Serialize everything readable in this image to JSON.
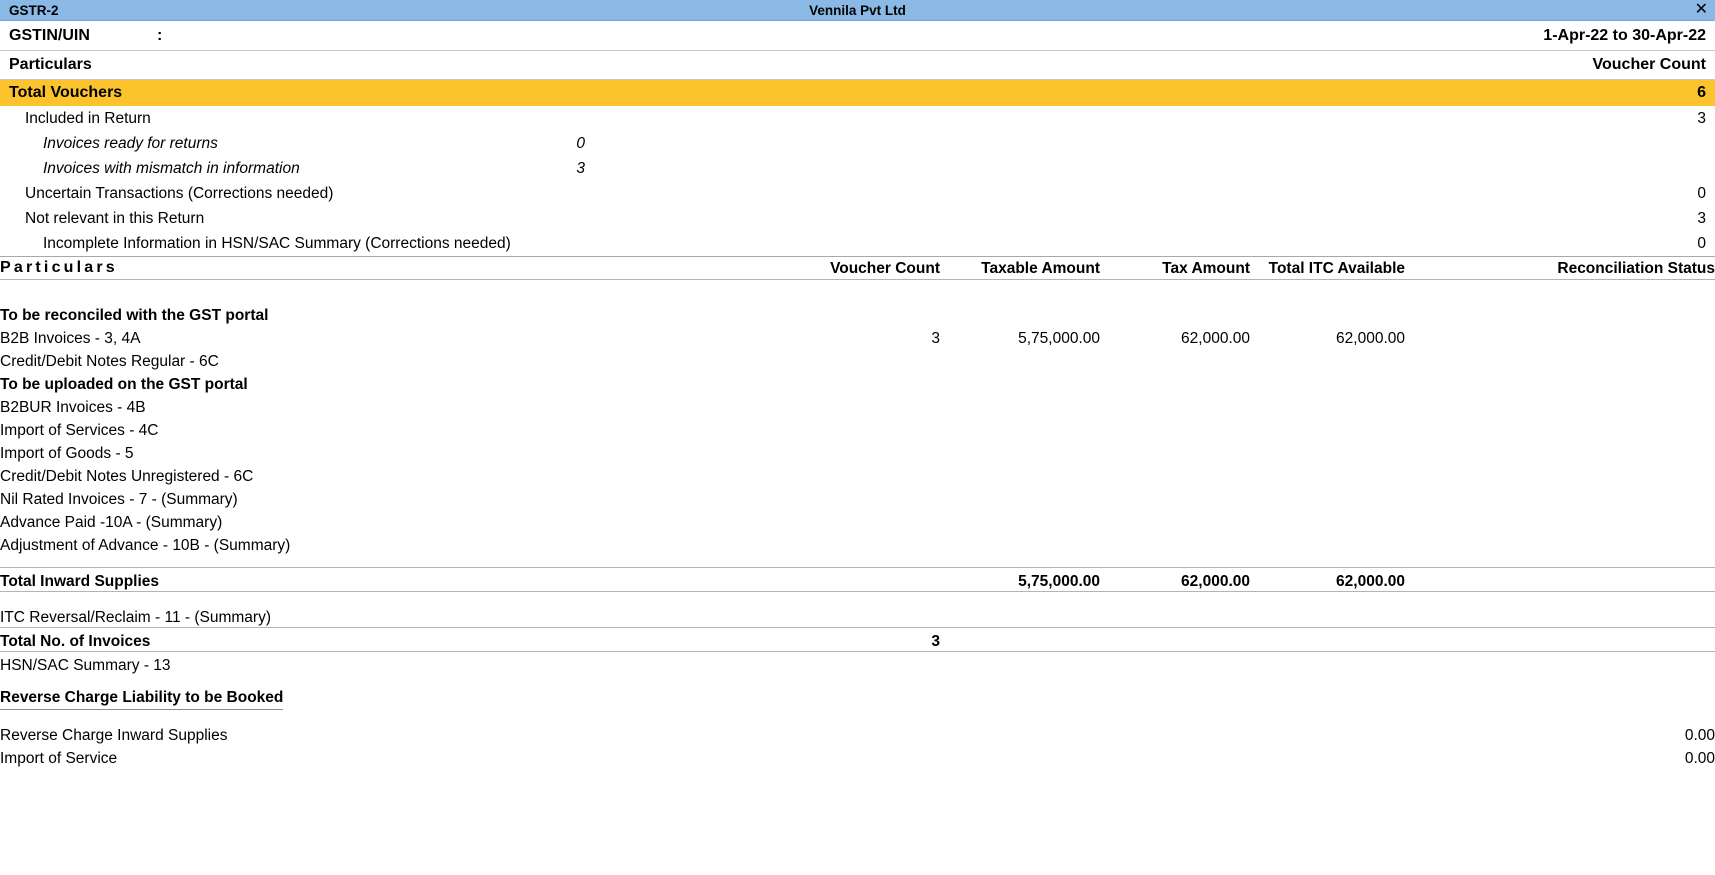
{
  "titlebar": {
    "app_name": "GSTR-2",
    "company": "Vennila Pvt Ltd",
    "close_label": "✕"
  },
  "header": {
    "gstin_label": "GSTIN/UIN",
    "colon": ":",
    "gstin_value": "",
    "period": "1-Apr-22 to 30-Apr-22",
    "particulars_label": "Particulars",
    "voucher_count_label": "Voucher Count"
  },
  "summary": {
    "total_vouchers": {
      "label": "Total Vouchers",
      "count": "6"
    },
    "rows": [
      {
        "label": "Included in Return",
        "indent": 1,
        "italic": false,
        "mid": "",
        "value": "3"
      },
      {
        "label": "Invoices ready for returns",
        "indent": 2,
        "italic": true,
        "mid": "0",
        "value": ""
      },
      {
        "label": "Invoices with mismatch in information",
        "indent": 2,
        "italic": true,
        "mid": "3",
        "value": ""
      },
      {
        "label": "Uncertain Transactions (Corrections needed)",
        "indent": 1,
        "italic": false,
        "mid": "",
        "value": "0"
      },
      {
        "label": "Not relevant in this Return",
        "indent": 1,
        "italic": false,
        "mid": "",
        "value": "3"
      },
      {
        "label": "Incomplete Information in HSN/SAC Summary (Corrections needed)",
        "indent": 2,
        "italic": false,
        "mid": "",
        "value": "0"
      }
    ]
  },
  "table": {
    "columns": {
      "particulars": "Particulars",
      "voucher_count": "Voucher\nCount",
      "taxable_amount": "Taxable\nAmount",
      "tax_amount": "Tax\nAmount",
      "total_itc": "Total ITC\nAvailable",
      "reconciliation_status": "Reconciliation\nStatus"
    },
    "group_reconciled": "To be reconciled with the GST portal",
    "group_uploaded": "To be uploaded on the GST portal",
    "rows_reconciled": [
      {
        "label": "B2B Invoices - 3, 4A",
        "voucher_count": "3",
        "taxable_amount": "5,75,000.00",
        "tax_amount": "62,000.00",
        "total_itc": "62,000.00",
        "reconciliation_status": ""
      },
      {
        "label": "Credit/Debit Notes Regular - 6C",
        "voucher_count": "",
        "taxable_amount": "",
        "tax_amount": "",
        "total_itc": "",
        "reconciliation_status": ""
      }
    ],
    "rows_uploaded": [
      {
        "label": "B2BUR Invoices - 4B",
        "voucher_count": "",
        "taxable_amount": "",
        "tax_amount": "",
        "total_itc": "",
        "reconciliation_status": ""
      },
      {
        "label": "Import of Services - 4C",
        "voucher_count": "",
        "taxable_amount": "",
        "tax_amount": "",
        "total_itc": "",
        "reconciliation_status": ""
      },
      {
        "label": "Import of Goods - 5",
        "voucher_count": "",
        "taxable_amount": "",
        "tax_amount": "",
        "total_itc": "",
        "reconciliation_status": ""
      },
      {
        "label": "Credit/Debit Notes Unregistered - 6C",
        "voucher_count": "",
        "taxable_amount": "",
        "tax_amount": "",
        "total_itc": "",
        "reconciliation_status": ""
      },
      {
        "label": "Nil Rated Invoices - 7 - (Summary)",
        "voucher_count": "",
        "taxable_amount": "",
        "tax_amount": "",
        "total_itc": "",
        "reconciliation_status": ""
      },
      {
        "label": "Advance Paid -10A - (Summary)",
        "voucher_count": "",
        "taxable_amount": "",
        "tax_amount": "",
        "total_itc": "",
        "reconciliation_status": ""
      },
      {
        "label": "Adjustment of Advance - 10B - (Summary)",
        "voucher_count": "",
        "taxable_amount": "",
        "tax_amount": "",
        "total_itc": "",
        "reconciliation_status": ""
      }
    ],
    "total_inward": {
      "label": "Total Inward Supplies",
      "voucher_count": "",
      "taxable_amount": "5,75,000.00",
      "tax_amount": "62,000.00",
      "total_itc": "62,000.00",
      "reconciliation_status": ""
    },
    "itc_reversal": {
      "label": "ITC Reversal/Reclaim - 11 - (Summary)",
      "voucher_count": "",
      "taxable_amount": "",
      "tax_amount": "",
      "total_itc": "",
      "reconciliation_status": ""
    },
    "total_invoices": {
      "label": "Total No. of Invoices",
      "voucher_count": "3",
      "taxable_amount": "",
      "tax_amount": "",
      "total_itc": "",
      "reconciliation_status": ""
    },
    "hsn_summary": {
      "label": "HSN/SAC Summary - 13",
      "voucher_count": "",
      "taxable_amount": "",
      "tax_amount": "",
      "total_itc": "",
      "reconciliation_status": ""
    },
    "reverse_charge_heading": "Reverse Charge Liability to be Booked",
    "reverse_charge_rows": [
      {
        "label": "Reverse Charge Inward Supplies",
        "value": "0.00"
      },
      {
        "label": "Import of Service",
        "value": "0.00"
      }
    ]
  },
  "colors": {
    "titlebar": "#8ab9e6",
    "highlight": "#fcc32c",
    "rule": "#c8c8c8"
  }
}
